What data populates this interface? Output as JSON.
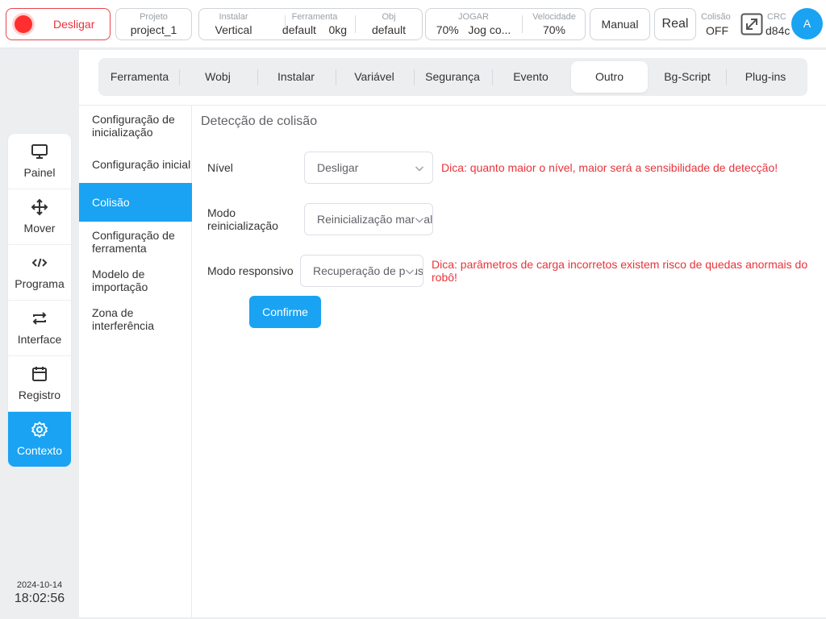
{
  "topbar": {
    "power": {
      "label": "Desligar",
      "led_color": "#ff2f2f"
    },
    "project": {
      "label": "Projeto",
      "value": "project_1"
    },
    "install": {
      "label": "Instalar",
      "value": "Vertical"
    },
    "tool": {
      "label": "Ferramenta",
      "value": "default",
      "weight": "0kg"
    },
    "obj": {
      "label": "Obj",
      "value": "default"
    },
    "jog": {
      "label": "JOGAR",
      "value": "70%",
      "mode": "Jog co..."
    },
    "speed": {
      "label": "Velocidade",
      "value": "70%"
    },
    "manual_btn": "Manual",
    "real_btn": "Real",
    "collision": {
      "label": "Colisão",
      "value": "OFF"
    },
    "crc": {
      "label": "CRC",
      "value": "d84c"
    },
    "avatar": "A"
  },
  "nav": {
    "items": [
      {
        "label": "Painel",
        "icon": "monitor-icon"
      },
      {
        "label": "Mover",
        "icon": "move-icon"
      },
      {
        "label": "Programa",
        "icon": "code-icon"
      },
      {
        "label": "Interface",
        "icon": "swap-icon"
      },
      {
        "label": "Registro",
        "icon": "calendar-icon"
      },
      {
        "label": "Contexto",
        "icon": "gear-icon",
        "active": true
      }
    ],
    "date": "2024-10-14",
    "time": "18:02:56"
  },
  "tabs": [
    "Ferramenta",
    "Wobj",
    "Instalar",
    "Variável",
    "Segurança",
    "Evento",
    "Outro",
    "Bg-Script",
    "Plug-ins"
  ],
  "active_tab": "Outro",
  "subnav": [
    "Configuração de inicialização",
    "Configuração inicial",
    "Colisão",
    "Configuração de ferramenta",
    "Modelo de importação",
    "Zona de interferência"
  ],
  "active_subnav": "Colisão",
  "content": {
    "title": "Detecção de colisão",
    "level": {
      "label": "Nível",
      "value": "Desligar",
      "hint": "Dica: quanto maior o nível, maior será a sensibilidade de detecção!"
    },
    "reset_mode": {
      "label": "Modo reinicialização",
      "value": "Reinicialização manual"
    },
    "response_mode": {
      "label": "Modo responsivo",
      "value": "Recuperação de pausa",
      "hint": "Dica: parâmetros de carga incorretos existem risco de quedas anormais do robô!"
    },
    "confirm": "Confirme"
  },
  "colors": {
    "accent": "#1aa3f2",
    "danger": "#e8333a"
  }
}
